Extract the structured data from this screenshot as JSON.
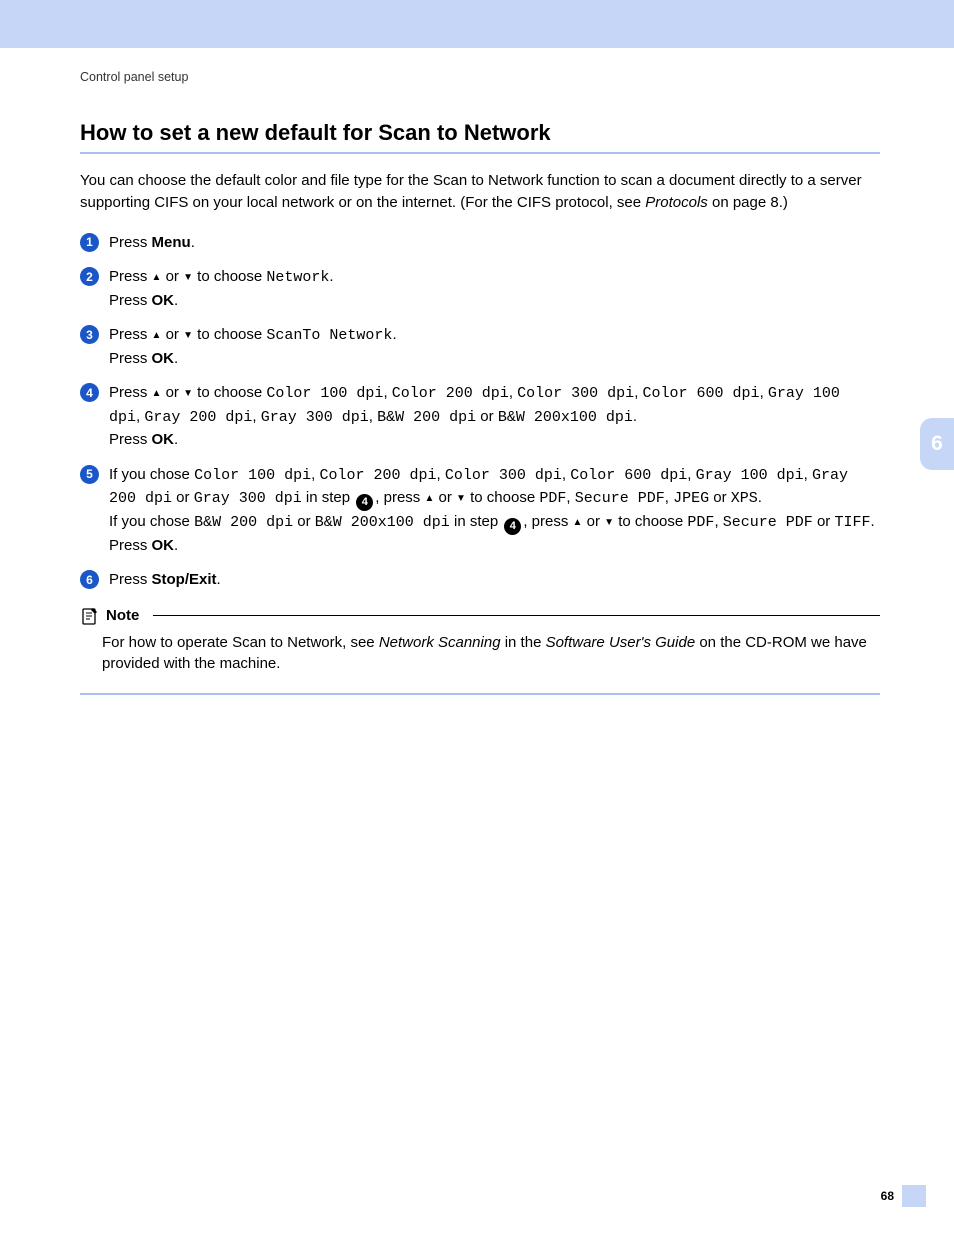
{
  "breadcrumb": "Control panel setup",
  "title": "How to set a new default for Scan to Network",
  "intro": {
    "t1": "You can choose the default color and file type for the Scan to Network function to scan a document directly to a server supporting CIFS on your local network or on the internet. (For the CIFS protocol, see ",
    "protocols": "Protocols",
    "t2": " on page 8.)"
  },
  "glyph": {
    "up": "▲",
    "down": "▼"
  },
  "labels": {
    "press": "Press ",
    "or": " or ",
    "to_choose": " to choose ",
    "press_ok": "OK",
    "period": ".",
    "comma": ", ",
    "in_step": " in step ",
    "press2": ", press ",
    "if_chose": "If you chose ",
    "or_txt": " or "
  },
  "menu": {
    "Menu": "Menu",
    "Network": "Network",
    "ScanToNetwork": "ScanTo Network",
    "StopExit": "Stop/Exit"
  },
  "dpi": {
    "c100": "Color 100 dpi",
    "c200": "Color 200 dpi",
    "c300": "Color 300 dpi",
    "c600": "Color 600 dpi",
    "g100": "Gray 100 dpi",
    "g200": "Gray 200 dpi",
    "g300": "Gray 300 dpi",
    "bw200": "B&W 200 dpi",
    "bw200x100": "B&W 200x100 dpi"
  },
  "fmt": {
    "PDF": "PDF",
    "SecurePDF": "Secure PDF",
    "JPEG": "JPEG",
    "XPS": "XPS",
    "TIFF": "TIFF"
  },
  "note": {
    "label": "Note",
    "t1": "For how to operate Scan to Network, see ",
    "i1": "Network Scanning",
    "t2": " in the ",
    "i2": "Software User's Guide",
    "t3": " on the CD-ROM we have provided with the machine."
  },
  "chapter_tab": "6",
  "page_number": "68",
  "step_ref4": "4"
}
